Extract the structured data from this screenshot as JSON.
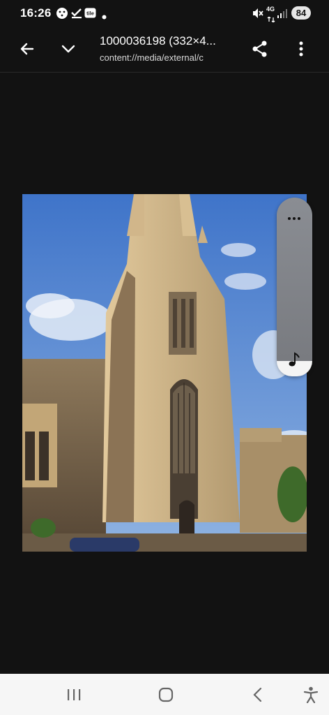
{
  "status_bar": {
    "time": "16:26",
    "network": "4G",
    "battery": "84",
    "notif_icons": [
      "activity-icon",
      "check-icon",
      "tile-app-icon",
      "dot-icon"
    ],
    "right_icons": [
      "mute-icon",
      "signal-icon"
    ]
  },
  "app_bar": {
    "title": "1000036198 (332×4...",
    "subtitle": "content://media/external/c",
    "icons": [
      "back-arrow-icon",
      "chevron-down-icon",
      "share-icon",
      "more-vert-icon"
    ]
  },
  "image": {
    "description_icon": "photo"
  },
  "music_panel": {
    "icons": [
      "more-horiz-icon",
      "music-note-icon"
    ]
  },
  "nav_bar": {
    "icons": [
      "recents-icon",
      "home-icon",
      "back-icon",
      "accessibility-icon"
    ]
  },
  "colors": {
    "background": "#121212",
    "navbar": "#f6f6f6",
    "panel": "#808388"
  }
}
